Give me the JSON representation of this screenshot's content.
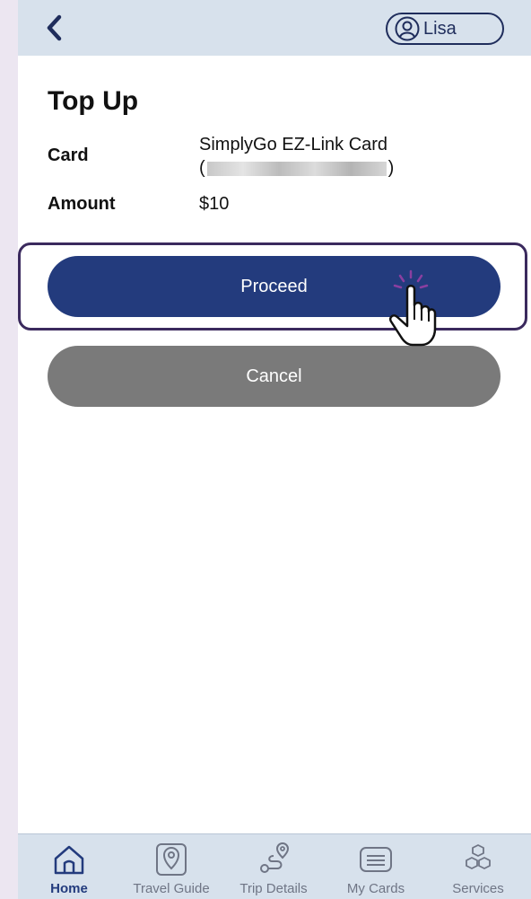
{
  "header": {
    "user_name": "Lisa"
  },
  "page": {
    "title": "Top Up",
    "card_label": "Card",
    "card_value": "SimplyGo EZ-Link Card",
    "card_number_open": "(",
    "card_number_close": ")",
    "amount_label": "Amount",
    "amount_value": "$10"
  },
  "buttons": {
    "proceed": "Proceed",
    "cancel": "Cancel"
  },
  "tabs": [
    {
      "label": "Home",
      "icon": "home-icon",
      "active": true
    },
    {
      "label": "Travel Guide",
      "icon": "location-pin-icon",
      "active": false
    },
    {
      "label": "Trip Details",
      "icon": "route-icon",
      "active": false
    },
    {
      "label": "My Cards",
      "icon": "card-icon",
      "active": false
    },
    {
      "label": "Services",
      "icon": "boxes-icon",
      "active": false
    }
  ],
  "colors": {
    "primary": "#233b7d",
    "cancel": "#7a7a7a",
    "header_bg": "#d7e1ec",
    "highlight_border": "#3b2a5e"
  }
}
